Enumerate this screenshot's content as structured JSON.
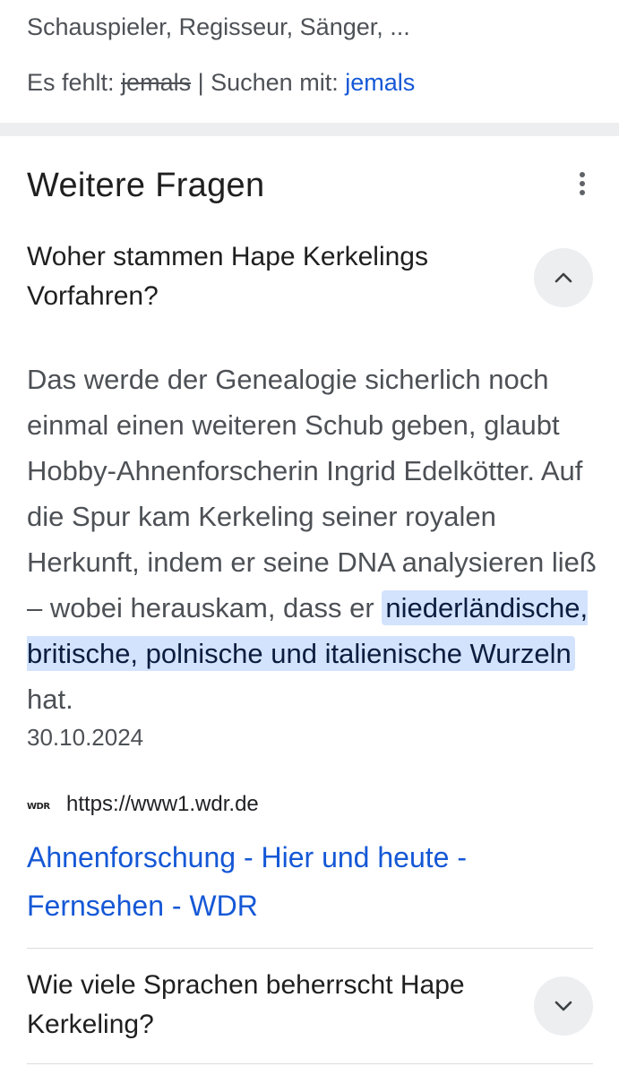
{
  "top_result": {
    "snippet_tail": "Schauspieler, Regisseur, Sänger, ...",
    "missing_label": "Es fehlt:",
    "missing_term": "jemals",
    "search_with_label": "| Suchen mit:",
    "search_with_term": "jemals"
  },
  "people_also_ask": {
    "title": "Weitere Fragen",
    "more_icon": "more-vert-icon",
    "questions": [
      {
        "text": "Woher stammen Hape Kerkelings Vorfahren?",
        "expanded": true,
        "answer_before": "Das werde der Genealogie sicherlich noch einmal einen weiteren Schub geben, glaubt Hobby-Ahnenforscherin Ingrid Edelkötter. Auf die Spur kam Kerkeling seiner royalen Herkunft, indem er seine DNA analysieren ließ – wobei herauskam, dass er",
        "answer_highlight": "niederländische, britische, polnische und italienische Wurzeln",
        "answer_after": "hat.",
        "date": "30.10.2024",
        "source_logo": "WDR",
        "source_url": "https://www1.wdr.de",
        "result_title": "Ahnenforschung - Hier und heute - Fernsehen - WDR"
      },
      {
        "text": "Wie viele Sprachen beherrscht Hape Kerkeling?",
        "expanded": false
      }
    ]
  },
  "colors": {
    "link": "#1558d6",
    "highlight": "#d3e3fd",
    "separator": "#eceef0",
    "secondary_text": "#4d5156"
  }
}
